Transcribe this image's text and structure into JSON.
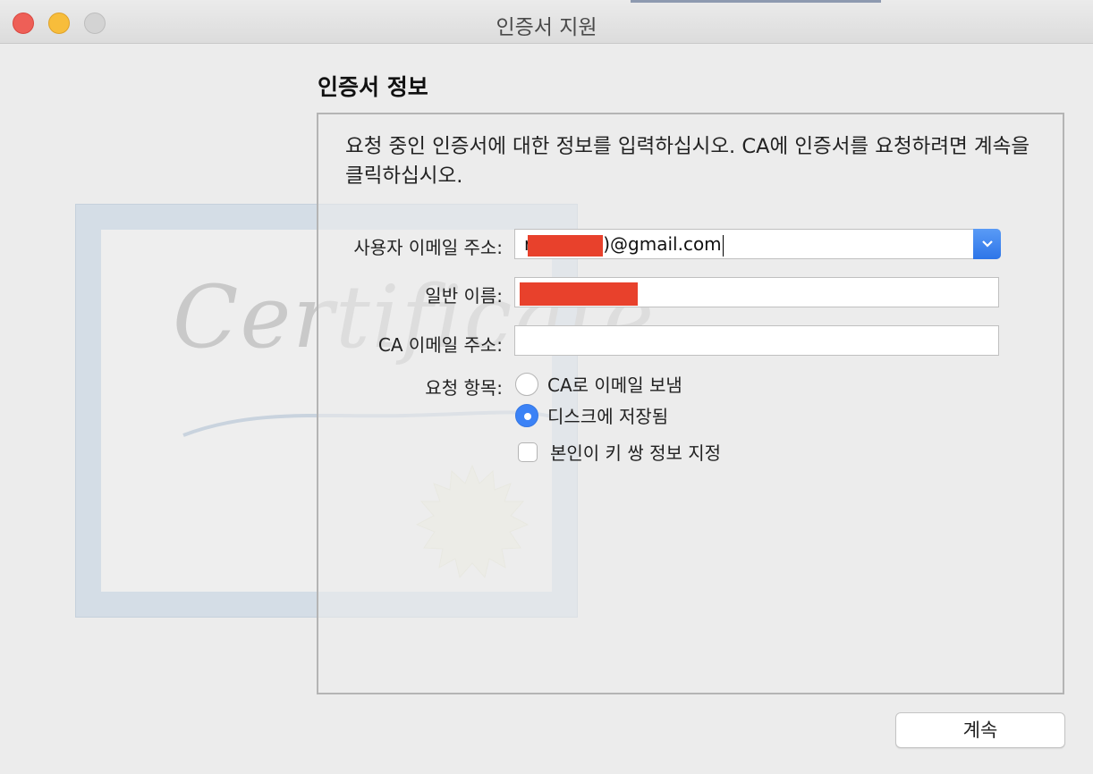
{
  "window": {
    "title": "인증서 지원"
  },
  "section": {
    "title": "인증서 정보"
  },
  "description": "요청 중인 인증서에 대한 정보를 입력하십시오. CA에 인증서를 요청하려면 계속을 클릭하십시오.",
  "certificate_art": {
    "word": "Certificate"
  },
  "form": {
    "user_email": {
      "label": "사용자 이메일 주소:",
      "value_prefix": "r",
      "value_suffix": ")@gmail.com"
    },
    "common_name": {
      "label": "일반 이름:",
      "value": ""
    },
    "ca_email": {
      "label": "CA 이메일 주소:",
      "value": ""
    },
    "request": {
      "label": "요청 항목:",
      "options": [
        {
          "label": "CA로 이메일 보냄",
          "selected": false
        },
        {
          "label": "디스크에 저장됨",
          "selected": true
        }
      ],
      "checkbox": {
        "label": "본인이 키 쌍 정보 지정",
        "checked": false
      }
    }
  },
  "buttons": {
    "continue": "계속"
  },
  "colors": {
    "accent": "#3b82f6",
    "redaction": "#e8412c"
  }
}
